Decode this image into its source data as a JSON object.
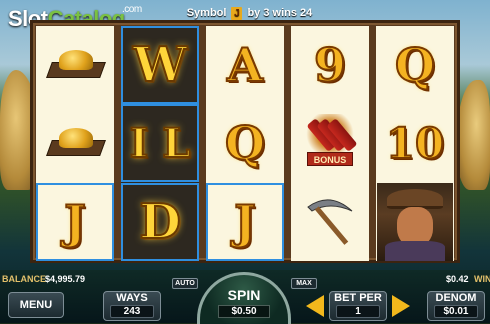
{
  "logo": {
    "slot": "Slot",
    "catalog": "Catalog",
    "com": ".com"
  },
  "topbar": {
    "prefix": "Symbol",
    "symbol_glyph": "J",
    "suffix": "by 3 wins 24"
  },
  "reels": [
    [
      "gold-pile",
      "gold-pile",
      "J"
    ],
    [
      "W",
      "I L",
      "D"
    ],
    [
      "A",
      "Q",
      "J"
    ],
    [
      "9",
      "dynamite",
      "pickaxe"
    ],
    [
      "Q",
      "10",
      "miner"
    ]
  ],
  "symbols": {
    "bonus_label": "BONUS"
  },
  "footer": {
    "balance_label": "BALANCE",
    "balance_value": "$4,995.79",
    "win_value": "$0.42",
    "win_label": "WIN",
    "menu_label": "MENU",
    "ways_label": "WAYS",
    "ways_value": "243",
    "auto_label": "AUTO",
    "spin_label": "SPIN",
    "spin_value": "$0.50",
    "max_label": "MAX",
    "betper_label": "BET PER",
    "betper_value": "1",
    "denom_label": "DENOM",
    "denom_value": "$0.01"
  },
  "colors": {
    "win_highlight": "#2f8fe0",
    "arrow": "#f2b81c",
    "letter_gold": "#f4b321"
  }
}
